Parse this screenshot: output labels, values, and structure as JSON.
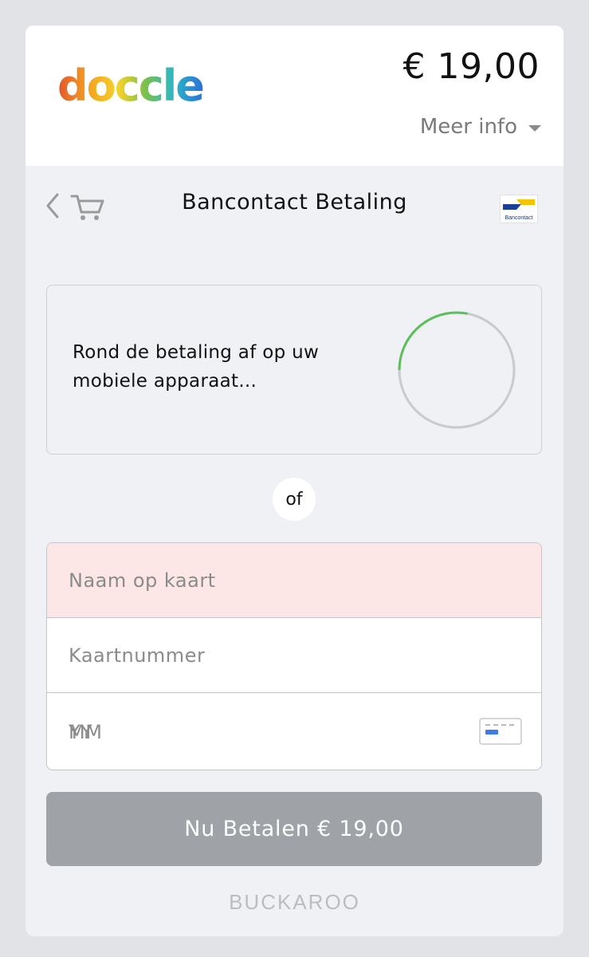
{
  "header": {
    "brand": "doccle",
    "amount": "€ 19,00",
    "meer_info": "Meer info"
  },
  "nav": {
    "title": "Bancontact Betaling",
    "method_logo_text": "Bancontact"
  },
  "mobile": {
    "message": "Rond de betaling af op uw mobiele apparaat...",
    "progress_fraction": 0.28
  },
  "separator": "of",
  "form": {
    "name_placeholder": "Naam op kaart",
    "card_placeholder": "Kaartnummer",
    "month_placeholder": "MM",
    "year_placeholder": "YY"
  },
  "pay_button": "Nu Betalen € 19,00",
  "footer": "BUCKAROO",
  "colors": {
    "name_field_error_bg": "#fde6e6",
    "spinner_progress": "#5cbf5b",
    "pay_button_disabled": "#9fa2a6"
  }
}
